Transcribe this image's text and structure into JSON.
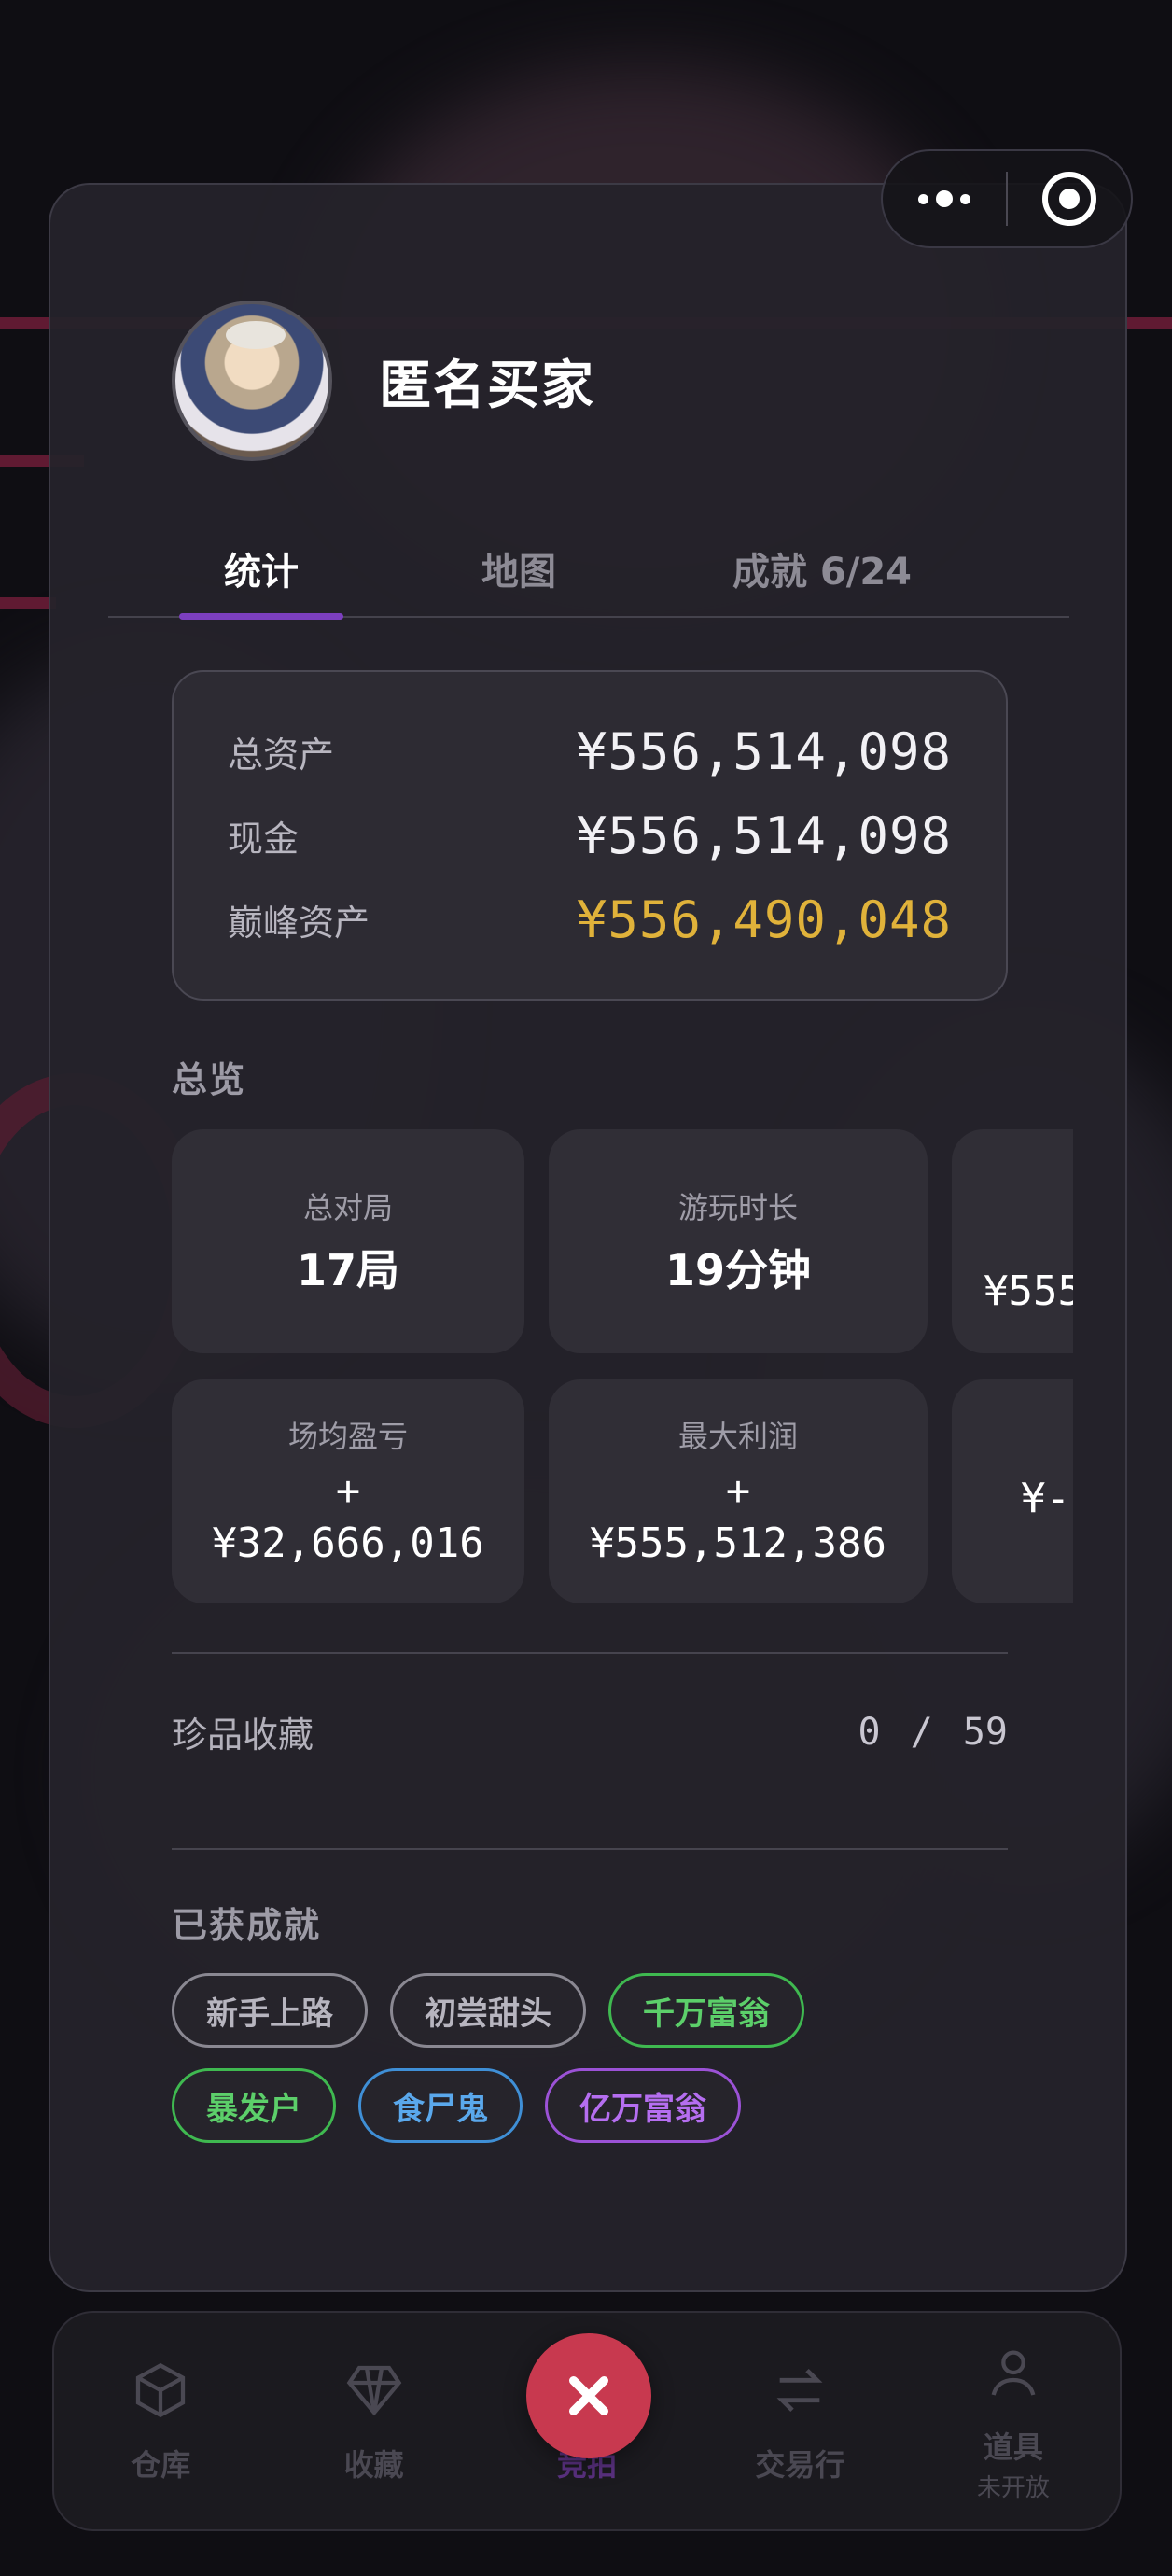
{
  "header": {
    "username": "匿名买家"
  },
  "capsule": {
    "more_icon": "more-dots-icon",
    "close_icon": "target-close-icon"
  },
  "tabs": [
    {
      "label": "统计",
      "active": true
    },
    {
      "label": "地图",
      "active": false
    },
    {
      "label": "成就 6/24",
      "active": false
    }
  ],
  "assets": [
    {
      "label": "总资产",
      "value": "¥556,514,098",
      "highlight": false
    },
    {
      "label": "现金",
      "value": "¥556,514,098",
      "highlight": false
    },
    {
      "label": "巅峰资产",
      "value": "¥556,490,048",
      "highlight": true
    }
  ],
  "overview": {
    "title": "总览",
    "tiles_row1": [
      {
        "label": "总对局",
        "value": "17局"
      },
      {
        "label": "游玩时长",
        "value": "19分钟"
      },
      {
        "label": "",
        "value": "¥555"
      }
    ],
    "tiles_row2": [
      {
        "label": "场均盈亏",
        "sign": "+",
        "value": "¥32,666,016"
      },
      {
        "label": "最大利润",
        "sign": "+",
        "value": "¥555,512,386"
      },
      {
        "label": "",
        "sign": "",
        "value": "¥-"
      }
    ]
  },
  "collection": {
    "label": "珍品收藏",
    "value": "0 / 59"
  },
  "achievements": {
    "title": "已获成就",
    "badges": [
      {
        "label": "新手上路",
        "color": "#8a8892"
      },
      {
        "label": "初尝甜头",
        "color": "#8a8892"
      },
      {
        "label": "千万富翁",
        "color": "#3fb950"
      },
      {
        "label": "暴发户",
        "color": "#3fb950"
      },
      {
        "label": "食尸鬼",
        "color": "#3f8fd6"
      },
      {
        "label": "亿万富翁",
        "color": "#9b52d6"
      }
    ]
  },
  "bottom_nav": {
    "items": [
      {
        "label": "仓库",
        "icon": "box-icon"
      },
      {
        "label": "收藏",
        "icon": "diamond-icon"
      },
      {
        "label": "竞拍",
        "icon": "close-icon",
        "active": true
      },
      {
        "label": "交易行",
        "icon": "swap-icon"
      },
      {
        "label": "道具",
        "sub": "未开放",
        "icon": "user-icon"
      }
    ]
  },
  "colors": {
    "accent": "#7c3fbf",
    "gold": "#e0b23a",
    "center_button": "#c8394f"
  }
}
